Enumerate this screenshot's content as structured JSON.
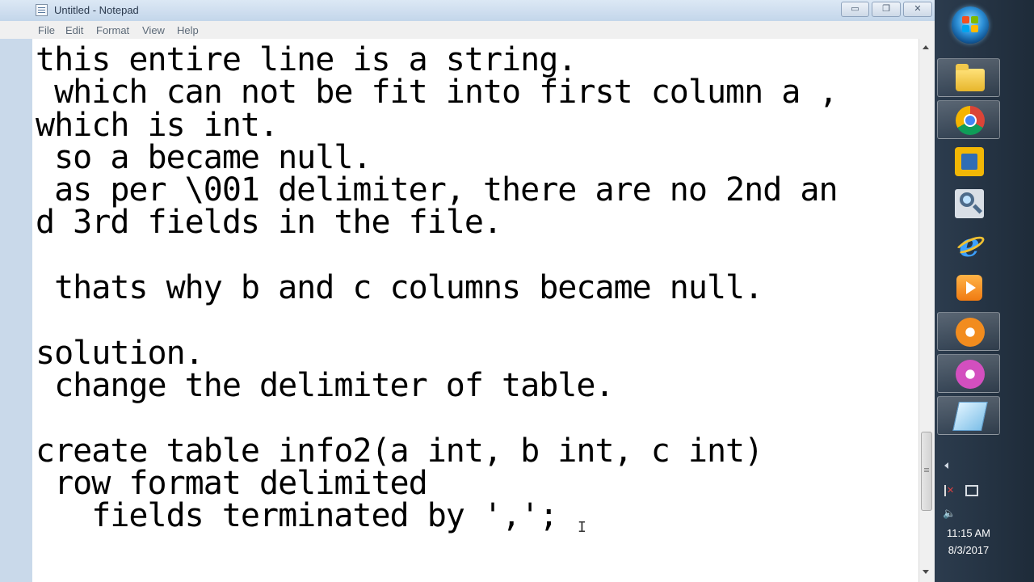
{
  "window": {
    "title": "Untitled - Notepad",
    "buttons": {
      "minimize": "▭",
      "maximize": "❐",
      "close": "✕"
    }
  },
  "menu": [
    "File",
    "Edit",
    "Format",
    "View",
    "Help"
  ],
  "editor": {
    "text": "this entire line is a string.\n which can not be fit into first column a ,\nwhich is int.\n so a became null.\n as per \\001 delimiter, there are no 2nd an\nd 3rd fields in the file.\n\n thats why b and c columns became null.\n\nsolution.\n change the delimiter of table.\n\ncreate table info2(a int, b int, c int)\n row format delimited\n   fields terminated by ',';",
    "cursor_glyph": "I"
  },
  "taskbar": {
    "items": [
      {
        "id": "folder",
        "icon": "folder-icon"
      },
      {
        "id": "chrome",
        "icon": "chrome-icon"
      },
      {
        "id": "vmware",
        "icon": "vmware-icon"
      },
      {
        "id": "magnifier",
        "icon": "magnifier-icon"
      },
      {
        "id": "ie",
        "icon": "internet-explorer-icon",
        "glyph": "e"
      },
      {
        "id": "media",
        "icon": "media-player-icon"
      },
      {
        "id": "orange",
        "icon": "app-orange-icon"
      },
      {
        "id": "pink",
        "icon": "app-pink-icon"
      },
      {
        "id": "notepad",
        "icon": "notepad-icon"
      }
    ],
    "clock": {
      "time": "11:15 AM",
      "date": "8/3/2017"
    },
    "volume_glyph": "🔈"
  },
  "colors": {
    "titlebar": "#c3d6ea",
    "taskbar": "#1e2b39",
    "accent": "#2c8fd6"
  }
}
